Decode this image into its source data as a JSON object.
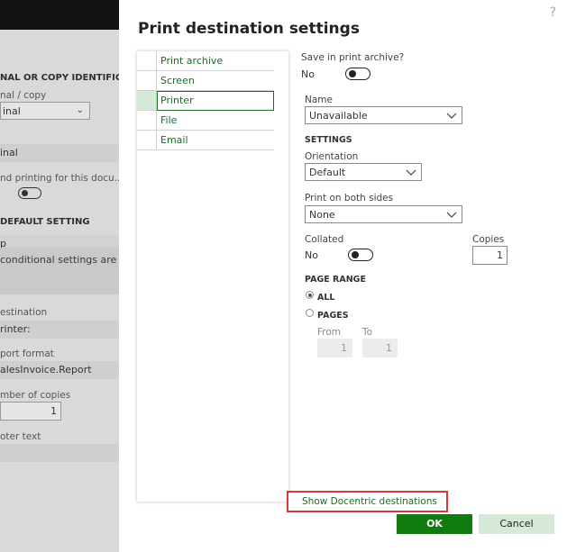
{
  "background": {
    "header_original_copy": "NAL OR COPY IDENTIFICATI",
    "label_original_copy": "nal / copy",
    "original_copy_value": "inal",
    "field_inal": "inal",
    "label_printing": "nd printing for this docu...",
    "header_default": "DEFAULT SETTING",
    "label_p": "p",
    "conditional_text": "conditional settings are n",
    "label_destination": "estination",
    "destination_value": "rinter:",
    "label_report_format": "port format",
    "report_format_value": "alesInvoice.Report",
    "label_copies": "mber of copies",
    "copies_value": "1",
    "label_footer": "oter text"
  },
  "dialog": {
    "title": "Print destination settings",
    "help": "?",
    "destinations": [
      {
        "label": "Print archive",
        "active": false
      },
      {
        "label": "Screen",
        "active": false
      },
      {
        "label": "Printer",
        "active": true
      },
      {
        "label": "File",
        "active": false
      },
      {
        "label": "Email",
        "active": false
      }
    ],
    "save_archive_label": "Save in print archive?",
    "save_archive_value": "No",
    "name_label": "Name",
    "name_value": "Unavailable",
    "settings_header": "SETTINGS",
    "orientation_label": "Orientation",
    "orientation_value": "Default",
    "both_sides_label": "Print on both sides",
    "both_sides_value": "None",
    "collated_label": "Collated",
    "collated_value": "No",
    "copies_label": "Copies",
    "copies_value": "1",
    "page_range_header": "PAGE RANGE",
    "range_all": "ALL",
    "range_pages": "PAGES",
    "from_label": "From",
    "from_value": "1",
    "to_label": "To",
    "to_value": "1",
    "docentric_link": "Show Docentric destinations",
    "ok_label": "OK",
    "cancel_label": "Cancel"
  },
  "colors": {
    "accent": "#107c10",
    "link": "#1e6b2a",
    "highlight_border": "#d43a3a",
    "cancel_bg": "#d6e9d9"
  }
}
